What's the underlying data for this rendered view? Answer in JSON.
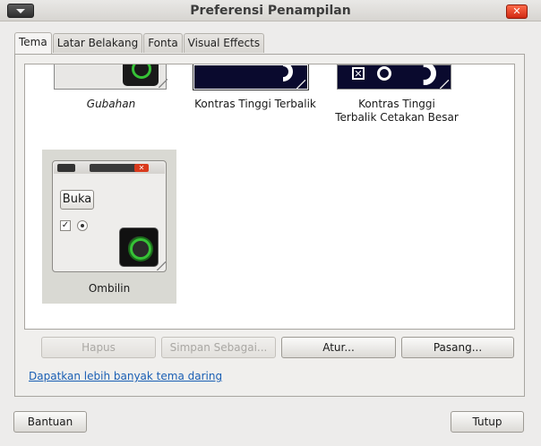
{
  "window": {
    "title": "Preferensi Penampilan",
    "close_glyph": "✕"
  },
  "tabs": [
    {
      "label": "Tema",
      "active": true
    },
    {
      "label": "Latar Belakang",
      "active": false
    },
    {
      "label": "Fonta",
      "active": false
    },
    {
      "label": "Visual Effects",
      "active": false
    }
  ],
  "themes": [
    {
      "name": "Gubahan",
      "italic": true
    },
    {
      "name": "Kontras Tinggi Terbalik",
      "italic": false
    },
    {
      "name_line1": "Kontras Tinggi",
      "name_line2": "Terbalik Cetakan Besar",
      "italic": false
    },
    {
      "name": "Ombilin",
      "selected": true,
      "preview_button": "Buka"
    }
  ],
  "buttons": {
    "delete": "Hapus",
    "save_as": "Simpan Sebagai...",
    "customize": "Atur...",
    "install": "Pasang...",
    "help": "Bantuan",
    "close": "Tutup"
  },
  "link": "Dapatkan lebih banyak tema daring",
  "colors": {
    "accent_link": "#1a5fb4",
    "selected_bg": "#d9d9d3",
    "dark_theme_bg": "#0a0a2e"
  }
}
